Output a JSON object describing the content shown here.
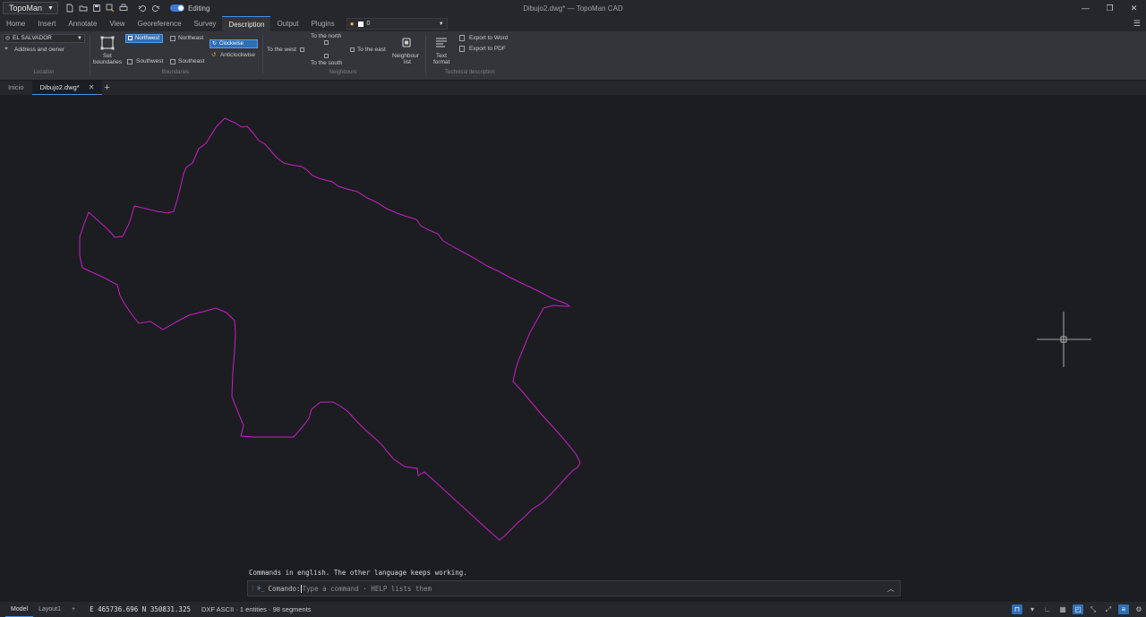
{
  "window": {
    "title": "Dibujo2.dwg* — TopoMan CAD"
  },
  "app_menu": {
    "label": "TopoMan"
  },
  "editing_toggle": {
    "label": "Editing",
    "on": true
  },
  "ribbon_tabs": [
    "Home",
    "Insert",
    "Annotate",
    "View",
    "Georeference",
    "Survey",
    "Description",
    "Output",
    "Plugins"
  ],
  "active_tab": "Description",
  "layer": {
    "name": "0",
    "color": "#ffffff"
  },
  "ribbon": {
    "location": {
      "country": "EL SALVADOR",
      "address_owner": "Address and owner",
      "group": "Location"
    },
    "boundaries": {
      "set_line1": "Set",
      "set_line2": "boundaries",
      "northwest": "Northwest",
      "northeast": "Northeast",
      "southwest": "Southwest",
      "southeast": "Southeast",
      "clockwise": "Clockwise",
      "anticlockwise": "Anticlockwise",
      "group": "Boundaries"
    },
    "neighbours": {
      "north": "To the north",
      "west": "To the west",
      "east": "To the east",
      "south": "To the south",
      "list_line1": "Neighbour",
      "list_line2": "list",
      "group": "Neighbours"
    },
    "technical": {
      "text_line1": "Text",
      "text_line2": "format",
      "word": "Export to Word",
      "pdf": "Export to PDF",
      "group": "Technical description"
    }
  },
  "doc_tabs": [
    "Inicio",
    "Dibujo2.dwg*"
  ],
  "active_doc": "Dibujo2.dwg*",
  "command": {
    "history": "Commands in english. The other language keeps working.",
    "label": "Comando:",
    "placeholder": "Type a command · HELP lists them"
  },
  "status": {
    "model": "Model",
    "layout": "Layout1",
    "coords": "E 465736.696 N 350831.325",
    "info": "DXF ASCII · 1 entities · 98 segments"
  },
  "colors": {
    "boundary": "#c81ec8",
    "accent": "#4a90e2",
    "canvas": "#1c1d21"
  }
}
